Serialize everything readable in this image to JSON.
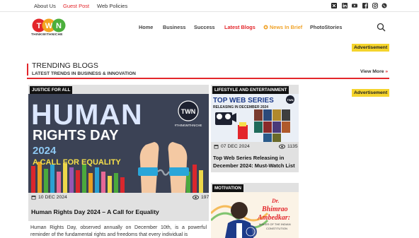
{
  "topbar": {
    "links": [
      "About Us",
      "Guest Post",
      "Web Policies"
    ],
    "social_icons": [
      "x-icon",
      "linkedin-icon",
      "youtube-icon",
      "facebook-icon",
      "instagram-icon",
      "whatsapp-icon"
    ]
  },
  "logo": {
    "letters": [
      "T",
      "W",
      "N"
    ],
    "tagline": "THINKWITHNICHE"
  },
  "nav": {
    "items": [
      "Home",
      "Business",
      "Success",
      "Latest Blogs",
      "News In Brief",
      "PhotoStories"
    ],
    "active_color": "#e3262b",
    "brief_color": "#f0a32a"
  },
  "ads": {
    "label": "Advertisement",
    "color": "#f5d42c"
  },
  "trending": {
    "title": "TRENDING BLOGS",
    "subtitle": "LATEST TRENDS IN BUSINESS & INNOVATION",
    "view_more": "View More",
    "view_more_arrow": "»"
  },
  "main_card": {
    "category": "JUSTICE FOR ALL",
    "image": {
      "line1": "HUMAN",
      "line2": "RIGHTS DAY",
      "line3": "2024",
      "line4": "A CALL FOR EQUALITY",
      "badge": "TWN",
      "badge_sub": "#THINKWITHNICHE"
    },
    "date": "10 DEC 2024",
    "views": "197",
    "title": "Human Rights Day 2024 – A Call for Equality",
    "excerpt": "Human Rights Day, observed annually on December 10th, is a powerful reminder of the fundamental rights and freedoms that every individual is"
  },
  "side_cards": [
    {
      "category": "LIFESTYLE AND ENTERTAINMENT",
      "image": {
        "line1": "TOP WEB SERIES",
        "line2": "RELEASING IN DECEMBER 2024",
        "badge": "TWN"
      },
      "date": "07 DEC 2024",
      "views": "1135",
      "title": "Top Web Series Releasing in December 2024: Must-Watch List"
    },
    {
      "category": "MOTIVATION",
      "image": {
        "line1": "Dr.",
        "line2": "Bhimrao",
        "line3": "Ambedkar:",
        "line4": "MAKER OF THE INDIAN",
        "line5": "CONSTITUTION"
      }
    }
  ]
}
